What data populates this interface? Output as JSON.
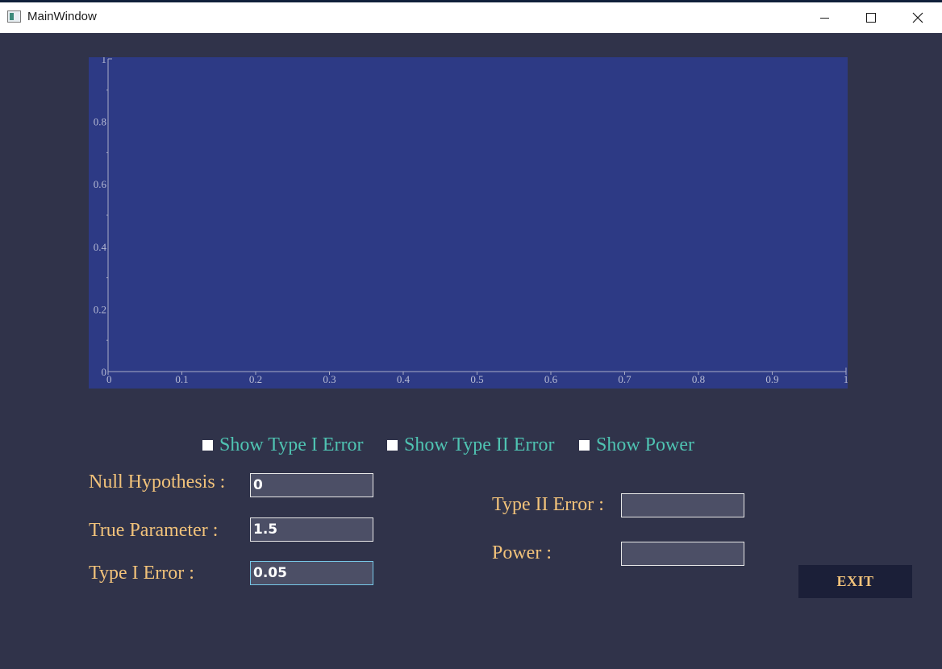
{
  "window": {
    "title": "MainWindow"
  },
  "chart_data": {
    "type": "line",
    "title": "",
    "xlabel": "",
    "ylabel": "",
    "xlim": [
      0,
      1
    ],
    "ylim": [
      0,
      1
    ],
    "x_ticks": [
      "0",
      "0.1",
      "0.2",
      "0.3",
      "0.4",
      "0.5",
      "0.6",
      "0.7",
      "0.8",
      "0.9",
      "1"
    ],
    "y_ticks": [
      "0",
      "0.2",
      "0.4",
      "0.6",
      "0.8",
      "1"
    ],
    "series": []
  },
  "checkboxes": {
    "type1": {
      "label": "Show Type I Error",
      "checked": false
    },
    "type2": {
      "label": "Show Type II Error",
      "checked": false
    },
    "power": {
      "label": "Show Power",
      "checked": false
    }
  },
  "form": {
    "null_label": "Null Hypothesis :",
    "null_value": "0",
    "true_label": "True Parameter :",
    "true_value": "1.5",
    "type1_label": "Type I Error :",
    "type1_value": "0.05",
    "type2_label": "Type II Error :",
    "type2_value": "",
    "power_label": "Power :",
    "power_value": ""
  },
  "exit_label": "EXIT",
  "colors": {
    "background": "#30334a",
    "plot_bg": "#2d3a85",
    "label": "#f1c27a",
    "checkbox_label": "#4fc3b2"
  }
}
